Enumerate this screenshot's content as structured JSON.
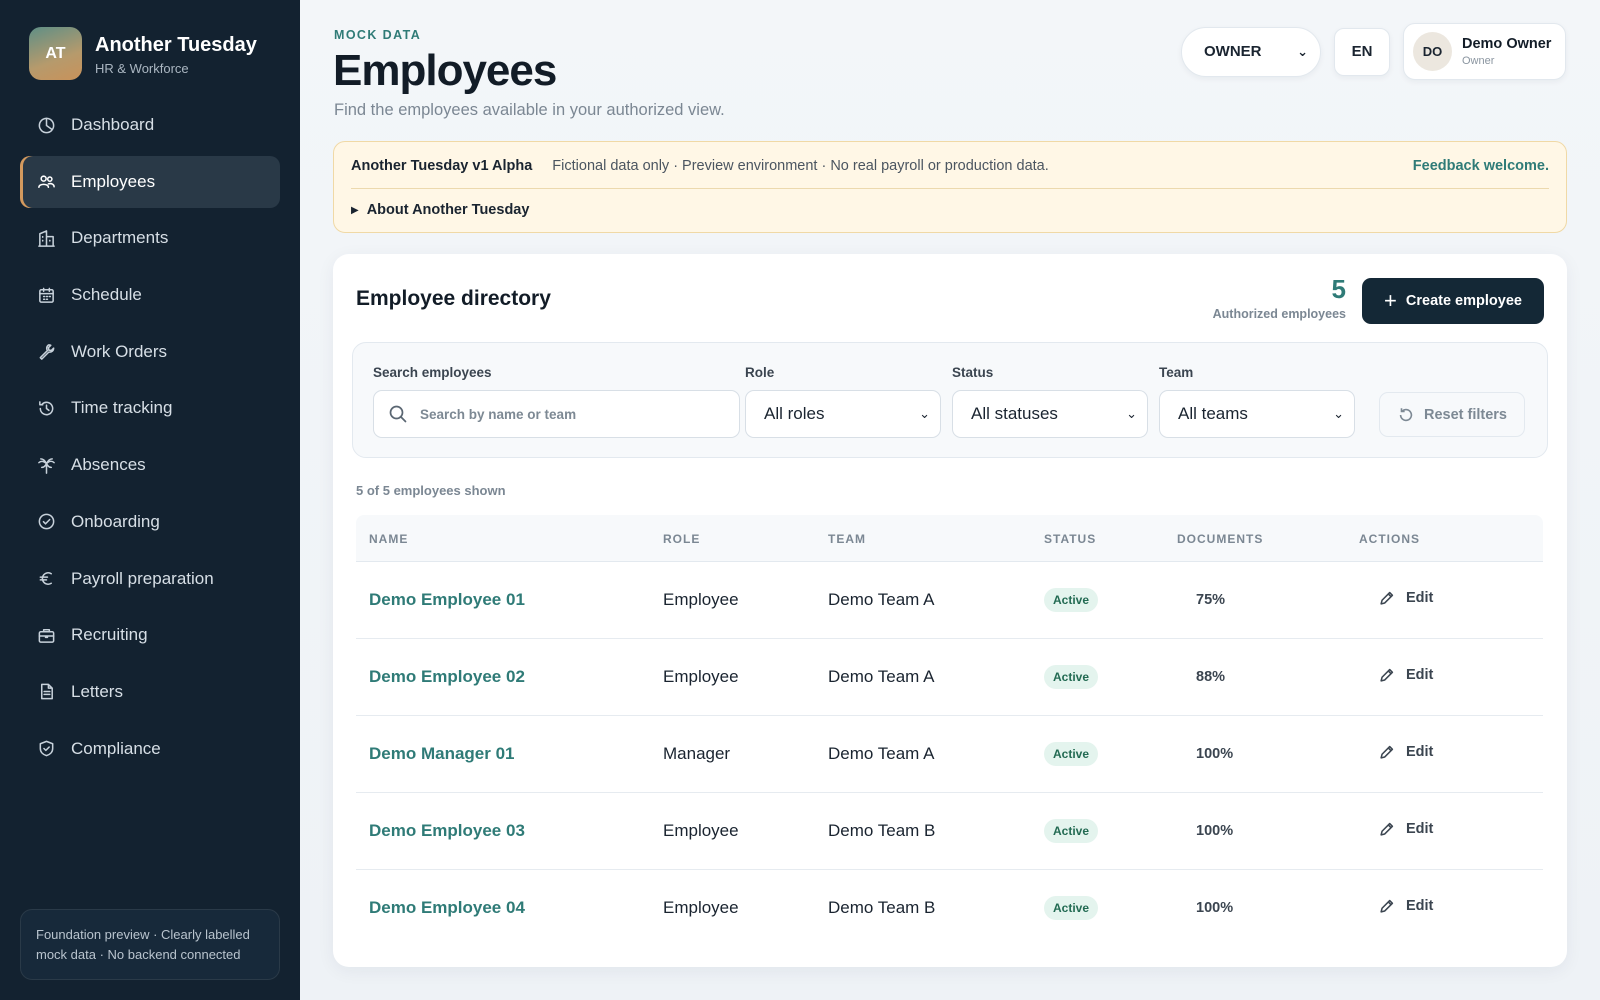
{
  "brand": {
    "initials": "AT",
    "name": "Another Tuesday",
    "subtitle": "HR & Workforce"
  },
  "nav": [
    {
      "label": "Dashboard",
      "icon": "dashboard-icon",
      "active": false
    },
    {
      "label": "Employees",
      "icon": "users-icon",
      "active": true
    },
    {
      "label": "Departments",
      "icon": "building-icon",
      "active": false
    },
    {
      "label": "Schedule",
      "icon": "calendar-icon",
      "active": false
    },
    {
      "label": "Work Orders",
      "icon": "wrench-icon",
      "active": false
    },
    {
      "label": "Time tracking",
      "icon": "history-icon",
      "active": false
    },
    {
      "label": "Absences",
      "icon": "palm-tree-icon",
      "active": false
    },
    {
      "label": "Onboarding",
      "icon": "check-circle-icon",
      "active": false
    },
    {
      "label": "Payroll preparation",
      "icon": "euro-icon",
      "active": false
    },
    {
      "label": "Recruiting",
      "icon": "briefcase-icon",
      "active": false
    },
    {
      "label": "Letters",
      "icon": "document-icon",
      "active": false
    },
    {
      "label": "Compliance",
      "icon": "shield-check-icon",
      "active": false
    }
  ],
  "sidebar_footer": "Foundation preview · Clearly labelled mock data · No backend connected",
  "header": {
    "eyebrow": "MOCK DATA",
    "title": "Employees",
    "subtitle": "Find the employees available in your authorized view.",
    "role_select": "OWNER",
    "language": "EN",
    "user": {
      "initials": "DO",
      "name": "Demo Owner",
      "role": "Owner"
    }
  },
  "notice": {
    "title": "Another Tuesday v1 Alpha",
    "text": "Fictional data only · Preview environment · No real payroll or production data.",
    "feedback": "Feedback welcome.",
    "about": "About Another Tuesday"
  },
  "directory": {
    "title": "Employee directory",
    "count": "5",
    "count_label": "Authorized employees",
    "create_label": "Create employee",
    "filters": {
      "search_label": "Search employees",
      "search_placeholder": "Search by name or team",
      "role_label": "Role",
      "role_value": "All roles",
      "status_label": "Status",
      "status_value": "All statuses",
      "team_label": "Team",
      "team_value": "All teams",
      "reset_label": "Reset filters"
    },
    "shown_text": "5 of 5 employees shown",
    "columns": [
      "NAME",
      "ROLE",
      "TEAM",
      "STATUS",
      "DOCUMENTS",
      "ACTIONS"
    ],
    "rows": [
      {
        "name": "Demo Employee 01",
        "role": "Employee",
        "team": "Demo Team A",
        "status": "Active",
        "documents": "75%",
        "action": "Edit"
      },
      {
        "name": "Demo Employee 02",
        "role": "Employee",
        "team": "Demo Team A",
        "status": "Active",
        "documents": "88%",
        "action": "Edit"
      },
      {
        "name": "Demo Manager 01",
        "role": "Manager",
        "team": "Demo Team A",
        "status": "Active",
        "documents": "100%",
        "action": "Edit"
      },
      {
        "name": "Demo Employee 03",
        "role": "Employee",
        "team": "Demo Team B",
        "status": "Active",
        "documents": "100%",
        "action": "Edit"
      },
      {
        "name": "Demo Employee 04",
        "role": "Employee",
        "team": "Demo Team B",
        "status": "Active",
        "documents": "100%",
        "action": "Edit"
      }
    ]
  },
  "colors": {
    "sidebar_bg": "#132230",
    "accent": "#2f7b77",
    "active_marker": "#d49a5e",
    "notice_bg": "#fff7e6"
  }
}
